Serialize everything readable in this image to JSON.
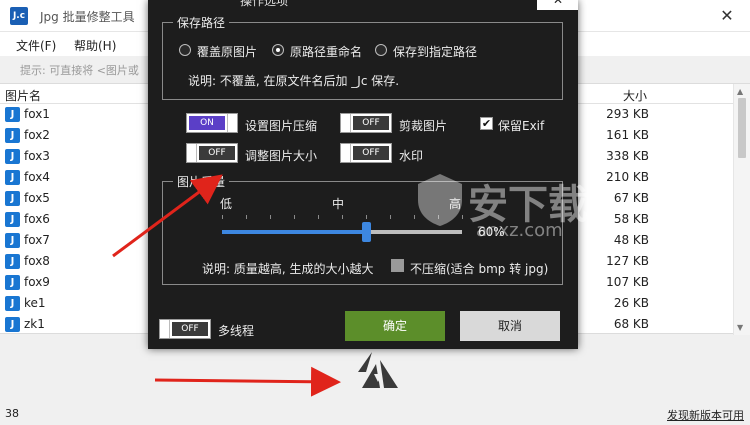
{
  "app": {
    "icon_text": "J.c",
    "title": "Jpg 批量修整工具",
    "close_glyph": "✕"
  },
  "menu": {
    "file": "文件(F)",
    "help": "帮助(H)"
  },
  "hint": "提示: 可直接将 <图片或",
  "table": {
    "col_name": "图片名",
    "col_size": "大小",
    "rows": [
      {
        "name": "fox1",
        "size": "293 KB"
      },
      {
        "name": "fox2",
        "size": "161 KB"
      },
      {
        "name": "fox3",
        "size": "338 KB"
      },
      {
        "name": "fox4",
        "size": "210 KB"
      },
      {
        "name": "fox5",
        "size": "67 KB"
      },
      {
        "name": "fox6",
        "size": "58 KB"
      },
      {
        "name": "fox7",
        "size": "48 KB"
      },
      {
        "name": "fox8",
        "size": "127 KB"
      },
      {
        "name": "fox9",
        "size": "107 KB"
      },
      {
        "name": "ke1",
        "size": "26 KB"
      },
      {
        "name": "zk1",
        "size": "68 KB"
      }
    ]
  },
  "status": {
    "count": "38",
    "new_version": "发现新版本可用"
  },
  "dialog": {
    "title": "操作选项",
    "close_glyph": "✕",
    "save_path": {
      "legend": "保存路径",
      "options": [
        "覆盖原图片",
        "原路径重命名",
        "保存到指定路径"
      ],
      "selected_index": 1,
      "description": "说明: 不覆盖, 在原文件名后加 _Jc 保存."
    },
    "options": {
      "compress": {
        "label": "设置图片压缩",
        "state": "ON"
      },
      "crop": {
        "label": "剪裁图片",
        "state": "OFF"
      },
      "keep_exif": {
        "label": "保留Exif",
        "checked": true
      },
      "resize": {
        "label": "调整图片大小",
        "state": "OFF"
      },
      "watermark": {
        "label": "水印",
        "state": "OFF"
      }
    },
    "quality": {
      "legend": "图片质量",
      "low": "低",
      "mid": "中",
      "high": "高",
      "value": 60,
      "value_text": "60%",
      "description": "说明: 质量越高, 生成的大小越大",
      "no_compress": {
        "label": "不压缩(适合 bmp 转 jpg)",
        "checked": false
      }
    },
    "multithread": {
      "label": "多线程",
      "state": "OFF"
    },
    "ok_button": "确定",
    "cancel_button": "取消"
  },
  "watermark_site": {
    "text": "安下载",
    "sub": "anxz.com"
  },
  "colors": {
    "dialog_bg": "#1d1d1d",
    "toggle_on": "#5b3fc7",
    "ok_button": "#5c8e2a",
    "slider": "#3d87e0",
    "arrow": "#e0241b"
  }
}
